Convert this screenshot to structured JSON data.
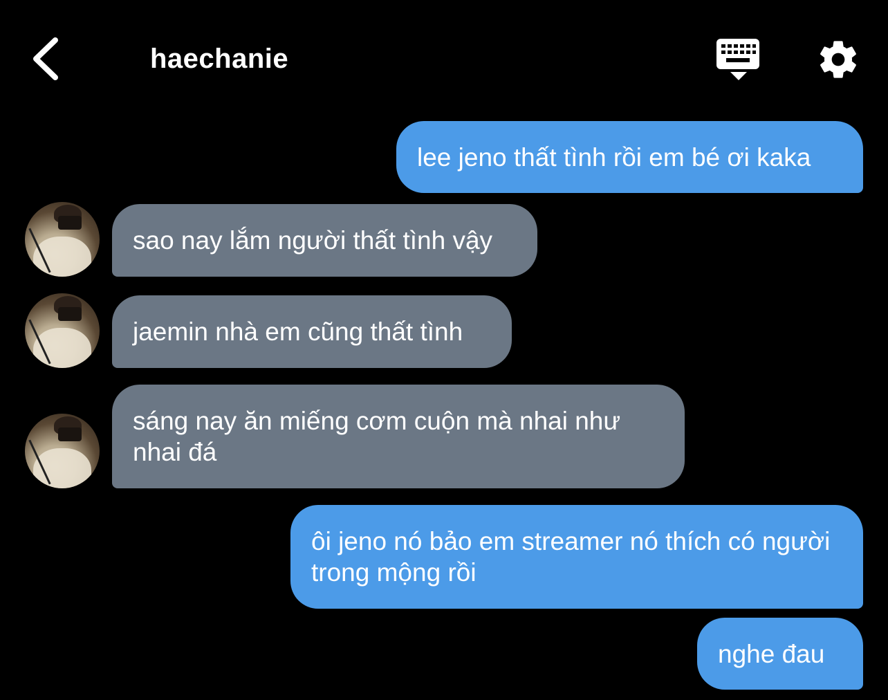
{
  "header": {
    "title": "haechanie",
    "back_icon": "chevron-left-icon",
    "keyboard_icon": "keyboard-icon",
    "settings_icon": "gear-icon"
  },
  "colors": {
    "background": "#000000",
    "outgoing_bubble": "#4c9be8",
    "incoming_bubble": "#6b7785",
    "text": "#ffffff"
  },
  "messages": [
    {
      "direction": "out",
      "text": "lee jeno thất tình rồi em bé ơi kaka"
    },
    {
      "direction": "in",
      "text": "sao nay lắm người thất tình vậy"
    },
    {
      "direction": "in",
      "text": "jaemin nhà em cũng thất tình"
    },
    {
      "direction": "in",
      "text": "sáng nay ăn miếng cơm cuộn mà nhai như nhai đá"
    },
    {
      "direction": "out",
      "text": "ôi jeno nó bảo em streamer nó thích có người trong mộng rồi"
    },
    {
      "direction": "out",
      "text": "nghe đau"
    }
  ]
}
